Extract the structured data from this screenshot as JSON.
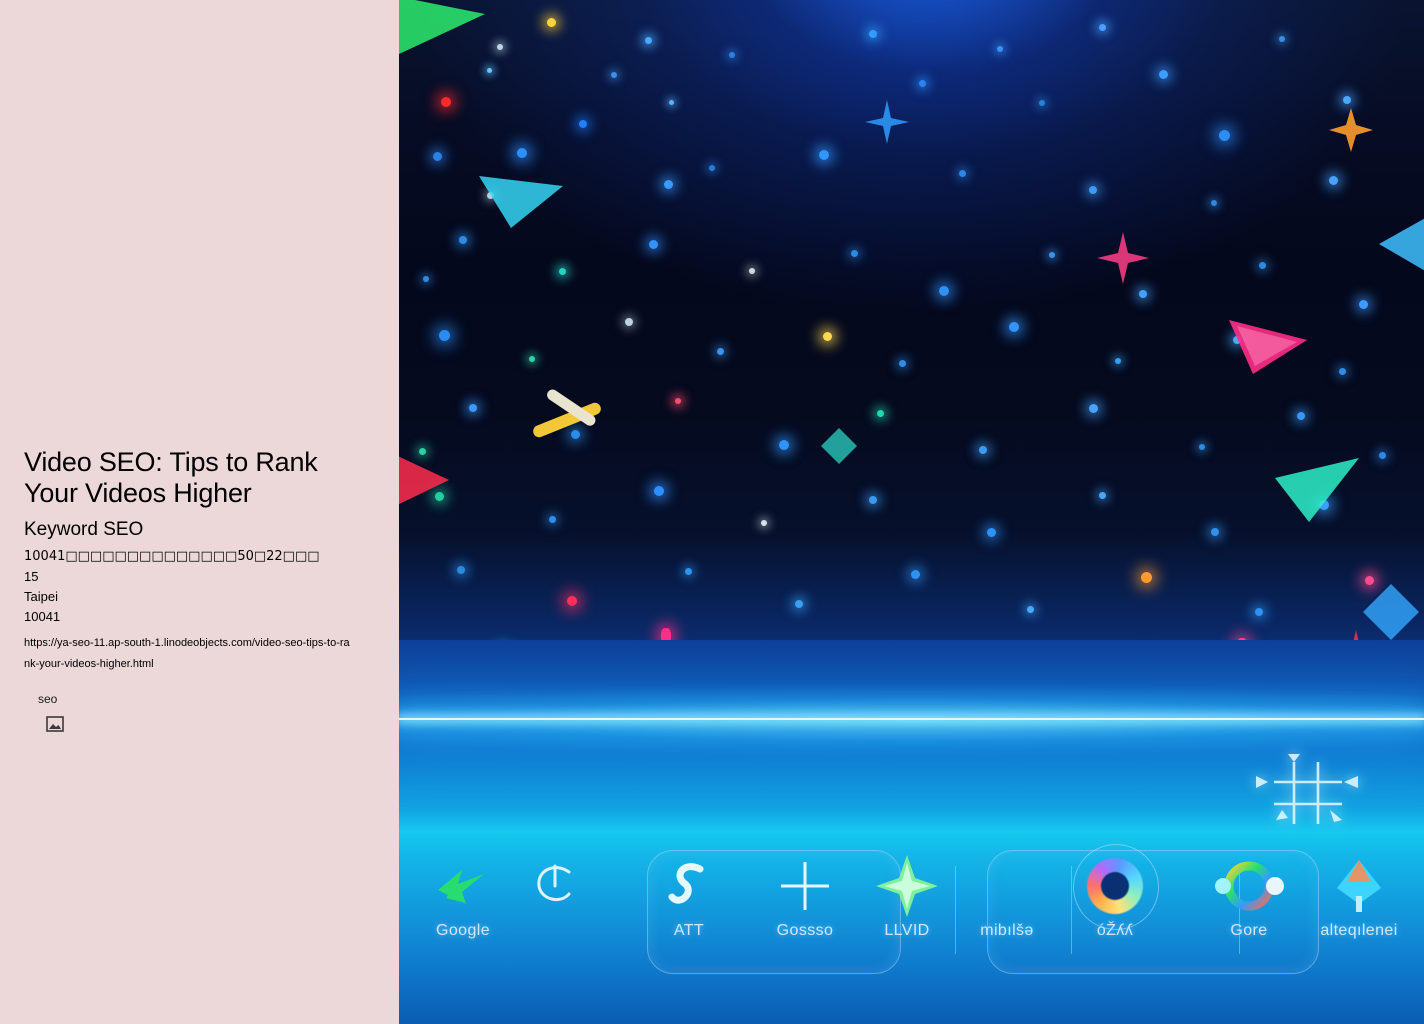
{
  "left_panel": {
    "background_color": "#ecd8d8",
    "article_title": "Video SEO: Tips to Rank\nYour Videos Higher",
    "keyword_label": "Keyword SEO",
    "address_line": "10041□□□□□□□□□□□□□□50□22□□□",
    "number_line": "15",
    "city_line": "Taipei",
    "postal_line": "10041",
    "url": "https://ya-seo-11.ap-south-1.linodeobjects.com/video-seo-tips-to-rank-your-videos-higher.html",
    "image_caption": "seo",
    "broken_image_icon": "broken-image-icon"
  },
  "hero_image": {
    "alt": "seo",
    "description": "Neon blue digital space scene with glowing particles, geometric shapes, a glowing horizon line and a row of illuminated brand-style icons",
    "palette": {
      "deep_space": "#04081c",
      "mid_blue": "#0e3f96",
      "horizon_cyan": "#17c8ef",
      "highlight": "#d9fbff",
      "accent_magenta": "#ff2e86",
      "accent_green": "#2ef08a",
      "accent_yellow": "#ffd23a"
    },
    "center_glyph": "crosshair-grid-icon",
    "dock": {
      "items": [
        {
          "label": "Google",
          "icon": "green-arrow-burst-icon"
        },
        {
          "label": "",
          "icon": "neon-c-hook-icon"
        },
        {
          "label": "ATT",
          "icon": "swirl-s-icon"
        },
        {
          "label": "Gossso",
          "icon": "plus-cross-icon"
        },
        {
          "label": "LLVID",
          "icon": "green-sparkle-diamond-icon"
        },
        {
          "label": "mibılšə",
          "icon": "blank-icon"
        },
        {
          "label": "óŽʎʎ",
          "icon": "google-circle-icon"
        },
        {
          "label": "Gore",
          "icon": "multicolor-orbit-icon"
        },
        {
          "label": "alteqılenei",
          "icon": "cyan-cone-icon"
        }
      ]
    }
  }
}
